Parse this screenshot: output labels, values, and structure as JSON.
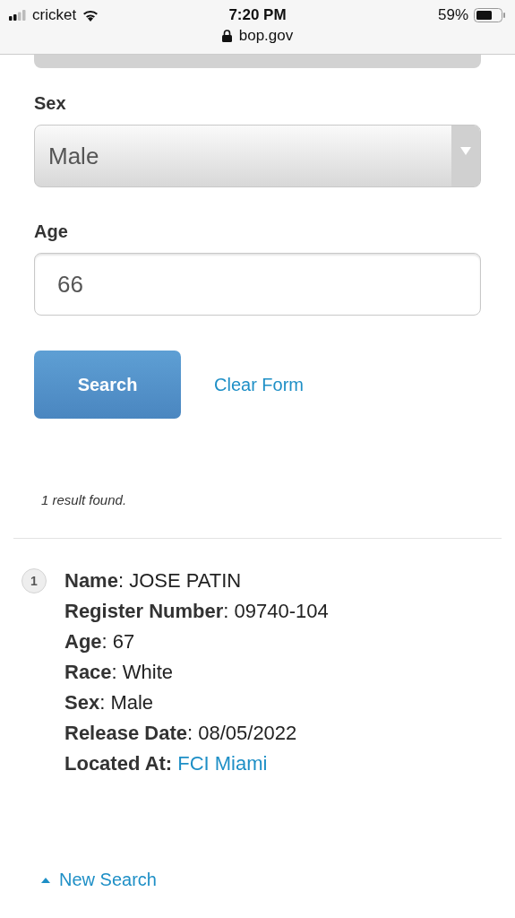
{
  "status_bar": {
    "carrier": "cricket",
    "time": "7:20 PM",
    "battery": "59%",
    "url": "bop.gov"
  },
  "form": {
    "fields": [
      {
        "kind": "select",
        "label": "Sex",
        "value": "Male"
      },
      {
        "kind": "input",
        "label": "Age",
        "value": "66"
      }
    ],
    "search_button": "Search",
    "clear_link": "Clear Form"
  },
  "results": {
    "count_text": "1 result found.",
    "items": [
      {
        "number": "1",
        "fields": [
          {
            "kind": "text",
            "text": "**Name**: JOSE PATIN"
          },
          {
            "kind": "text",
            "text": "**Register Number**: 09740-104"
          },
          {
            "kind": "text",
            "text": "**Age**: 67"
          },
          {
            "kind": "text",
            "text": "**Race**: White"
          },
          {
            "kind": "text",
            "text": "**Sex**: Male"
          },
          {
            "kind": "text",
            "text": "**Release Date**: 08/05/2022"
          },
          {
            "kind": "link",
            "label": "Located At:",
            "link": "FCI Miami"
          }
        ]
      }
    ]
  },
  "new_search_link": "New Search"
}
